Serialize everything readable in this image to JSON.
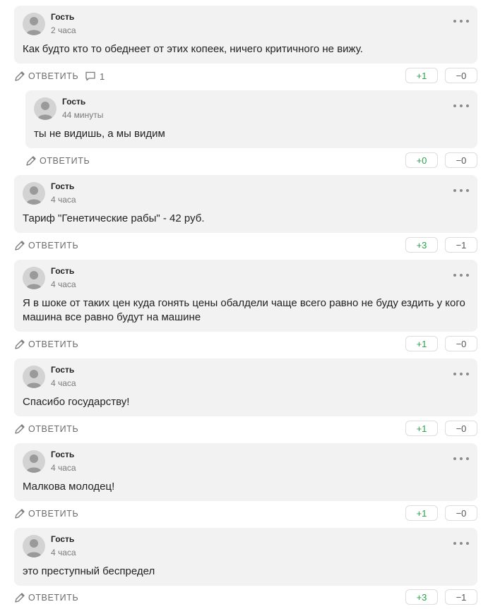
{
  "ui": {
    "reply_label": "ОТВЕТИТЬ"
  },
  "comments": [
    {
      "author": "Гость",
      "time": "2 часа",
      "text": "Как будто кто то обеднеет от этих копеек, ничего критичного не вижу.",
      "replies": "1",
      "up": "+1",
      "down": "−0",
      "nested": false
    },
    {
      "author": "Гость",
      "time": "44 минуты",
      "text": "ты не видишь, а мы видим",
      "replies": null,
      "up": "+0",
      "down": "−0",
      "nested": true
    },
    {
      "author": "Гость",
      "time": "4 часа",
      "text": "Тариф \"Генетические рабы\" - 42 руб.",
      "replies": null,
      "up": "+3",
      "down": "−1",
      "nested": false
    },
    {
      "author": "Гость",
      "time": "4 часа",
      "text": "Я в шоке от таких цен куда гонять цены обалдели чаще всего равно не буду ездить у кого машина все равно будут на машине",
      "replies": null,
      "up": "+1",
      "down": "−0",
      "nested": false
    },
    {
      "author": "Гость",
      "time": "4 часа",
      "text": "Спасибо государству!",
      "replies": null,
      "up": "+1",
      "down": "−0",
      "nested": false
    },
    {
      "author": "Гость",
      "time": "4 часа",
      "text": "Малкова молодец!",
      "replies": null,
      "up": "+1",
      "down": "−0",
      "nested": false
    },
    {
      "author": "Гость",
      "time": "4 часа",
      "text": "это преступный беспредел",
      "replies": null,
      "up": "+3",
      "down": "−1",
      "nested": false
    }
  ]
}
